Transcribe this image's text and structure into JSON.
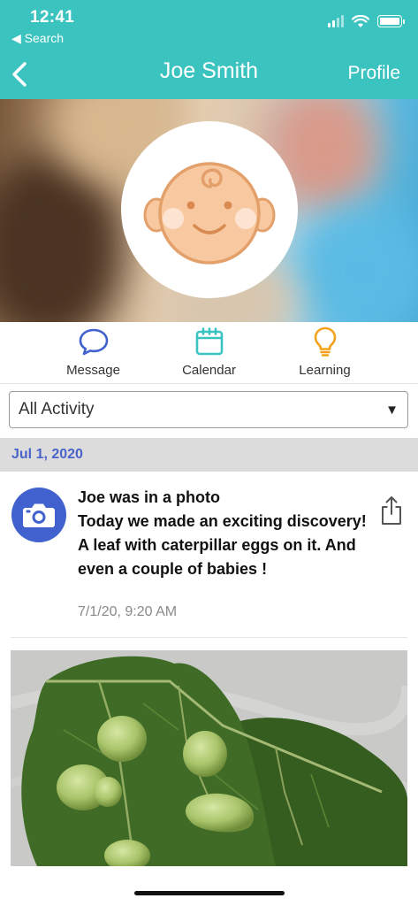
{
  "status_bar": {
    "time": "12:41",
    "back_label": "◀ Search"
  },
  "nav": {
    "title": "Joe Smith",
    "right_label": "Profile"
  },
  "actions": [
    {
      "label": "Message",
      "icon": "chat-bubble-icon",
      "color": "#4161ce"
    },
    {
      "label": "Calendar",
      "icon": "calendar-icon",
      "color": "#3bc3c0"
    },
    {
      "label": "Learning",
      "icon": "lightbulb-icon",
      "color": "#f3a31b"
    }
  ],
  "filter": {
    "value": "All Activity",
    "arrow": "▼"
  },
  "date_header": "Jul 1, 2020",
  "feed_item": {
    "title": "Joe was in a photo",
    "body": "Today we made an exciting discovery!  A leaf with caterpillar eggs on it.  And even a couple of babies !",
    "timestamp": "7/1/20, 9:20 AM",
    "icon": "camera-icon"
  },
  "colors": {
    "header": "#3bc3c0",
    "accent_blue": "#4161ce",
    "date_text": "#4a63c9",
    "date_bar": "#dcdcdc"
  }
}
